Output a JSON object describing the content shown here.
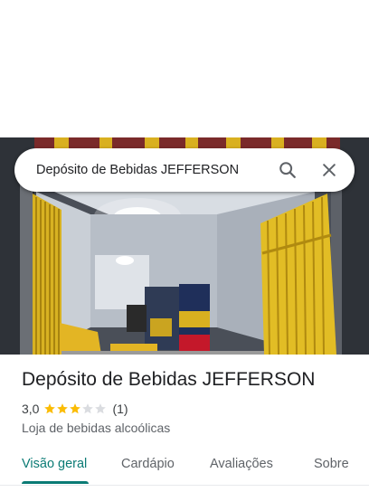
{
  "search": {
    "query": "Depósito de Bebidas JEFFERSON"
  },
  "place": {
    "name": "Depósito de Bebidas JEFFERSON",
    "rating_text": "3,0",
    "rating": 3,
    "rating_max": 5,
    "review_count": "(1)",
    "category": "Loja de bebidas alcoólicas"
  },
  "tabs": [
    {
      "label": "Visão geral",
      "active": true
    },
    {
      "label": "Cardápio",
      "active": false
    },
    {
      "label": "Avaliações",
      "active": false
    },
    {
      "label": "Sobre",
      "active": false
    }
  ],
  "colors": {
    "accent": "#0b7b75",
    "star_filled": "#fbbc04",
    "star_empty": "#dadce0"
  },
  "icons": {
    "search": "search-icon",
    "close": "close-icon",
    "star": "star-icon"
  }
}
